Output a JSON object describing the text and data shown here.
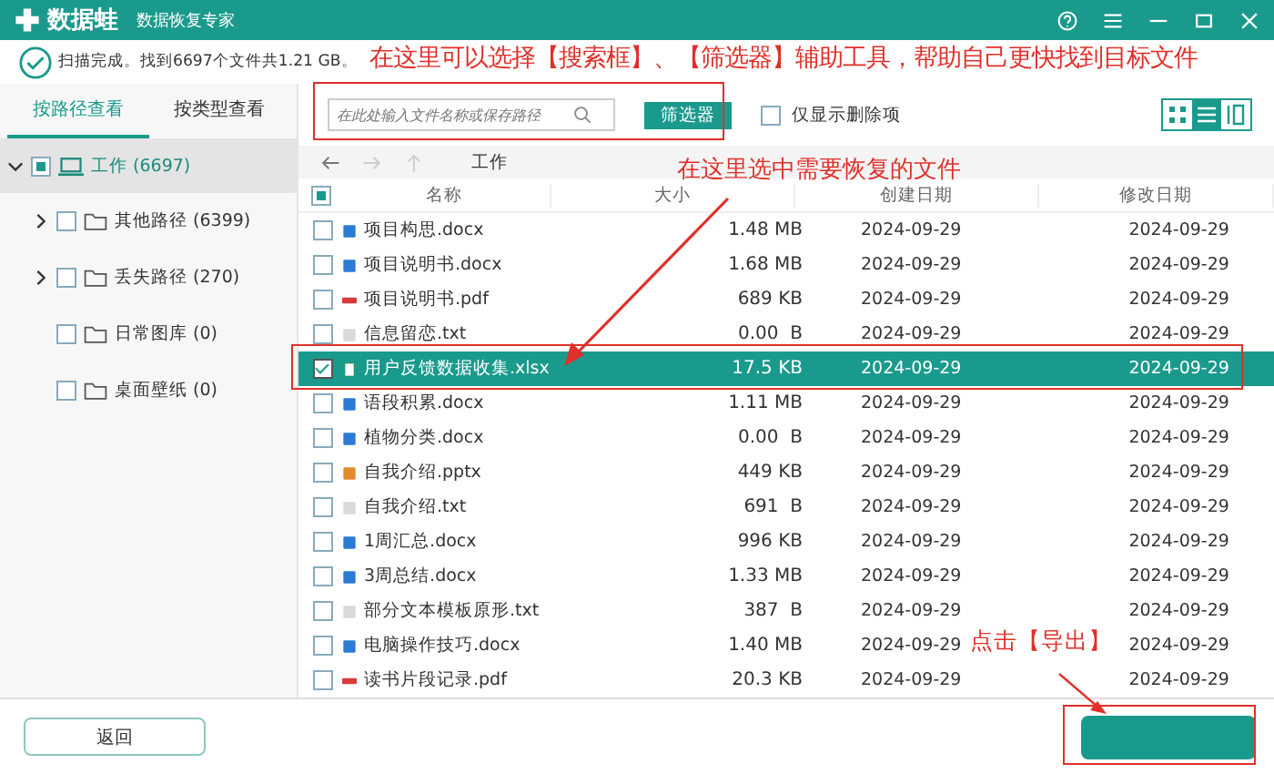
{
  "window": {
    "app_name": "数据蛙",
    "subtitle": "数据恢复专家"
  },
  "status": {
    "text": "扫描完成。找到6697个文件共1.21 GB。"
  },
  "view_tabs": [
    {
      "label": "按路径查看",
      "selected": true
    },
    {
      "label": "按类型查看",
      "selected": false
    }
  ],
  "tree": [
    {
      "label": "工作 (6697)",
      "expanded": true,
      "checked": false,
      "partial": true,
      "selected": true,
      "children": [
        {
          "label": "其他路径 (6399)",
          "expandable": true,
          "checked": false,
          "selected": false
        },
        {
          "label": "丢失路径 (270)",
          "expandable": true,
          "checked": false,
          "selected": false
        },
        {
          "label": "日常图库 (0)",
          "expandable": false,
          "checked": false,
          "selected": false
        },
        {
          "label": "桌面壁纸 (0)",
          "expandable": false,
          "checked": false,
          "selected": false
        }
      ]
    }
  ],
  "search": {
    "placeholder": "在此处输入文件名称或保存路径"
  },
  "filter_button": "筛选器",
  "deleted_only": {
    "label": "仅显示删除项",
    "checked": false
  },
  "view_modes": [
    {
      "kind": "grid",
      "selected": false
    },
    {
      "kind": "list",
      "selected": true
    },
    {
      "kind": "detail",
      "selected": false
    }
  ],
  "path": "工作",
  "table": {
    "header_partial": true,
    "columns": [
      "名称",
      "大小",
      "创建日期",
      "修改日期"
    ],
    "rows": [
      {
        "kind": "docx",
        "name": "项目构思.docx",
        "size": "1.48 MB",
        "created": "2024-09-29",
        "modified": "2024-09-29",
        "selected": false
      },
      {
        "kind": "docx",
        "name": "项目说明书.docx",
        "size": "1.68 MB",
        "created": "2024-09-29",
        "modified": "2024-09-29",
        "selected": false
      },
      {
        "kind": "pdf",
        "name": "项目说明书.pdf",
        "size": "689 KB",
        "created": "2024-09-29",
        "modified": "2024-09-29",
        "selected": false
      },
      {
        "kind": "txt",
        "name": "信息留恋.txt",
        "size": "0.00  B",
        "created": "2024-09-29",
        "modified": "2024-09-29",
        "selected": false
      },
      {
        "kind": "xlsx",
        "name": "用户反馈数据收集.xlsx",
        "size": "17.5 KB",
        "created": "2024-09-29",
        "modified": "2024-09-29",
        "selected": true
      },
      {
        "kind": "docx",
        "name": "语段积累.docx",
        "size": "1.11 MB",
        "created": "2024-09-29",
        "modified": "2024-09-29",
        "selected": false
      },
      {
        "kind": "docx",
        "name": "植物分类.docx",
        "size": "0.00  B",
        "created": "2024-09-29",
        "modified": "2024-09-29",
        "selected": false
      },
      {
        "kind": "pptx",
        "name": "自我介绍.pptx",
        "size": "449 KB",
        "created": "2024-09-29",
        "modified": "2024-09-29",
        "selected": false
      },
      {
        "kind": "txt",
        "name": "自我介绍.txt",
        "size": "691  B",
        "created": "2024-09-29",
        "modified": "2024-09-29",
        "selected": false
      },
      {
        "kind": "docx",
        "name": "1周汇总.docx",
        "size": "996 KB",
        "created": "2024-09-29",
        "modified": "2024-09-29",
        "selected": false
      },
      {
        "kind": "docx",
        "name": "3周总结.docx",
        "size": "1.33 MB",
        "created": "2024-09-29",
        "modified": "2024-09-29",
        "selected": false
      },
      {
        "kind": "txt",
        "name": "部分文本模板原形.txt",
        "size": "387  B",
        "created": "2024-09-29",
        "modified": "2024-09-29",
        "selected": false
      },
      {
        "kind": "docx",
        "name": "电脑操作技巧.docx",
        "size": "1.40 MB",
        "created": "2024-09-29",
        "modified": "2024-09-29",
        "selected": false
      },
      {
        "kind": "pdf",
        "name": "读书片段记录.pdf",
        "size": "20.3 KB",
        "created": "2024-09-29",
        "modified": "2024-09-29",
        "selected": false
      }
    ]
  },
  "back_button": "返回",
  "annotations": [
    "在这里可以选择【搜索框】、【筛选器】辅助工具，帮助自己更快找到目标文件",
    "在这里选中需要恢复的文件",
    "点击【导出】"
  ]
}
